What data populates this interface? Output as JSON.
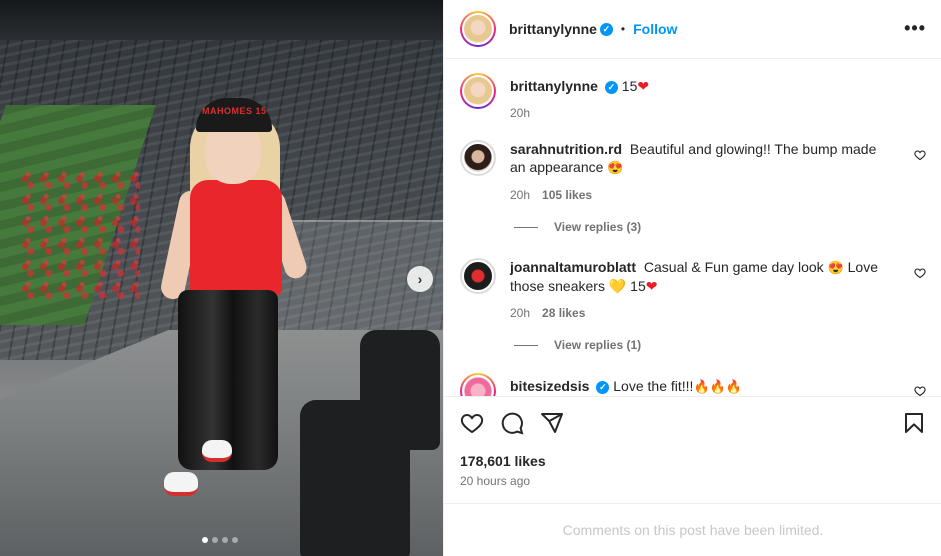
{
  "post": {
    "author": "brittanylynne",
    "follow_label": "Follow",
    "separator": "•",
    "more_label": "•••",
    "carousel": {
      "total": 4,
      "active": 0,
      "next_label": "›"
    },
    "photo_cap_text": "MAHOMES 15"
  },
  "caption": {
    "user": "brittanylynne",
    "text": "15",
    "emoji": "❤",
    "time": "20h"
  },
  "comments": [
    {
      "user": "sarahnutrition.rd",
      "verified": false,
      "text": "Beautiful and glowing!! The bump made an appearance",
      "emoji": "😍",
      "time": "20h",
      "likes": "105 likes",
      "replies": "View replies (3)"
    },
    {
      "user": "joannaltamuroblatt",
      "verified": false,
      "text": "Casual & Fun game day look",
      "emoji": "😍",
      "text2": "Love those sneakers",
      "emoji2": "💛",
      "text3": "15",
      "emoji3": "❤",
      "time": "20h",
      "likes": "28 likes",
      "replies": "View replies (1)"
    },
    {
      "user": "bitesizedsis",
      "verified": true,
      "text": "Love the fit!!!",
      "emoji": "🔥🔥🔥"
    }
  ],
  "footer": {
    "likes": "178,601 likes",
    "time": "20 hours ago",
    "limited": "Comments on this post have been limited."
  },
  "colors": {
    "accent": "#0095f6",
    "text": "#262626",
    "muted": "#737373",
    "heart": "#ed1c24"
  },
  "icons": [
    "heart-icon",
    "comment-icon",
    "share-icon",
    "bookmark-icon",
    "verified-icon",
    "more-icon",
    "next-icon"
  ]
}
